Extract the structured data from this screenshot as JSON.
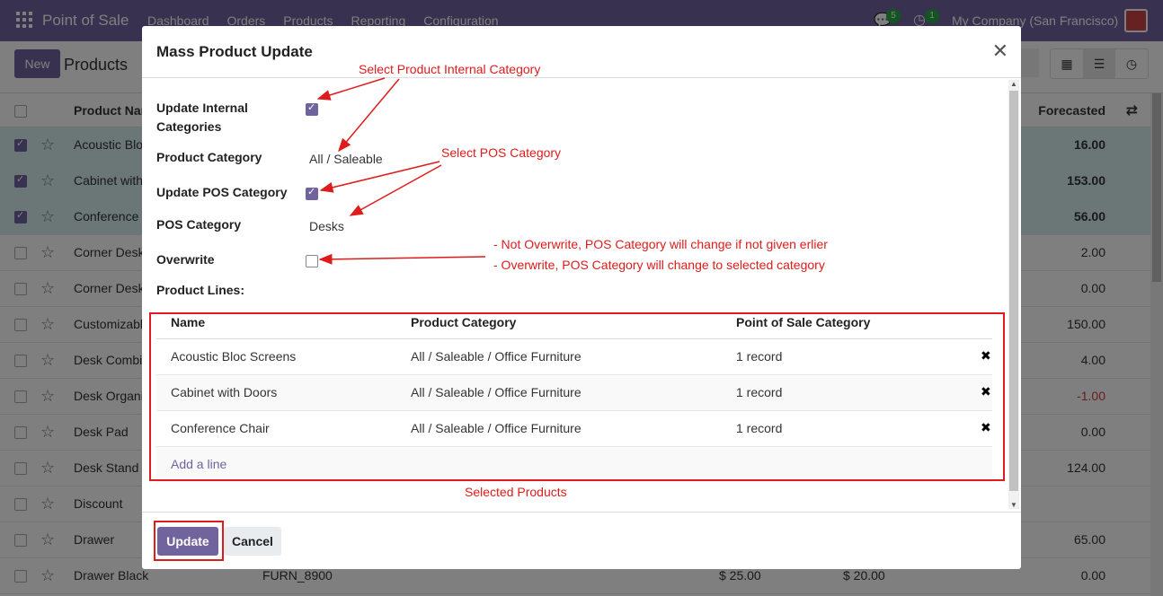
{
  "navbar": {
    "app_name": "Point of Sale",
    "menu": [
      "Dashboard",
      "Orders",
      "Products",
      "Reporting",
      "Configuration"
    ],
    "chat_badge": "5",
    "activity_badge": "1",
    "company": "My Company (San Francisco)"
  },
  "control": {
    "new_label": "New",
    "breadcrumb": "Products"
  },
  "list": {
    "headers": {
      "name": "Product Nam",
      "forecasted": "Forecasted"
    },
    "rows": [
      {
        "name": "Acoustic Bloc",
        "forecast": "16.00",
        "selected": true
      },
      {
        "name": "Cabinet with",
        "forecast": "153.00",
        "selected": true
      },
      {
        "name": "Conference",
        "forecast": "56.00",
        "selected": true
      },
      {
        "name": "Corner Desk",
        "forecast": "2.00",
        "selected": false
      },
      {
        "name": "Corner Desk",
        "forecast": "0.00",
        "selected": false
      },
      {
        "name": "Customizabl",
        "forecast": "150.00",
        "selected": false
      },
      {
        "name": "Desk Combi",
        "forecast": "4.00",
        "selected": false
      },
      {
        "name": "Desk Organi",
        "forecast": "-1.00",
        "selected": false
      },
      {
        "name": "Desk Pad",
        "forecast": "0.00",
        "selected": false
      },
      {
        "name": "Desk Stand w",
        "forecast": "124.00",
        "selected": false
      },
      {
        "name": "Discount",
        "forecast": "",
        "selected": false
      },
      {
        "name": "Drawer",
        "forecast": "65.00",
        "selected": false
      },
      {
        "name": "Drawer Black",
        "forecast": "0.00",
        "selected": false
      }
    ],
    "last_row_extra": {
      "ref": "FURN_8900",
      "price": "$ 25.00",
      "cost": "$ 20.00"
    }
  },
  "modal": {
    "title": "Mass Product Update",
    "fields": {
      "update_internal_label": "Update Internal Categories",
      "update_internal_checked": true,
      "product_category_label": "Product Category",
      "product_category_value": "All / Saleable",
      "update_pos_label": "Update POS Category",
      "update_pos_checked": true,
      "pos_category_label": "POS Category",
      "pos_category_value": "Desks",
      "overwrite_label": "Overwrite",
      "overwrite_checked": false,
      "product_lines_label": "Product Lines:"
    },
    "lines": {
      "headers": {
        "name": "Name",
        "category": "Product Category",
        "pos": "Point of Sale Category"
      },
      "rows": [
        {
          "name": "Acoustic Bloc Screens",
          "category": "All / Saleable / Office Furniture",
          "pos": "1 record"
        },
        {
          "name": "Cabinet with Doors",
          "category": "All / Saleable / Office Furniture",
          "pos": "1 record"
        },
        {
          "name": "Conference Chair",
          "category": "All / Saleable / Office Furniture",
          "pos": "1 record"
        }
      ],
      "add_line": "Add a line"
    },
    "buttons": {
      "update": "Update",
      "cancel": "Cancel"
    }
  },
  "annotations": {
    "internal_category": "Select Product Internal Category",
    "pos_category": "Select POS Category",
    "not_overwrite": "- Not Overwrite, POS Category will change if not given erlier",
    "overwrite": "- Overwrite, POS Category will change to selected category",
    "selected_products": "Selected Products",
    "color": "#e01b1b"
  },
  "colors": {
    "brand": "#71639e",
    "selected_row": "#d7ecec",
    "negative": "#d23f3a"
  }
}
